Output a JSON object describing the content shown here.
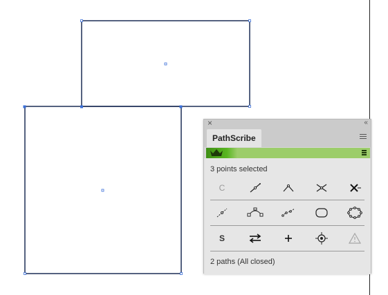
{
  "panel": {
    "close_glyph": "×",
    "collapse_glyph": "‹‹",
    "tab_label": "PathScribe",
    "selection_status": "3 points selected",
    "path_status": "2 paths (All closed)",
    "accent": "#58b521"
  },
  "buttons": {
    "row1": [
      {
        "icon": "c-letter-icon",
        "label": "C"
      },
      {
        "icon": "line-segment-icon"
      },
      {
        "icon": "corner-point-icon"
      },
      {
        "icon": "scissors-icon"
      },
      {
        "icon": "delete-point-icon"
      }
    ],
    "row2": [
      {
        "icon": "smooth-segment-icon"
      },
      {
        "icon": "arc-handles-icon"
      },
      {
        "icon": "distribute-points-icon"
      },
      {
        "icon": "smooth-shape-icon"
      },
      {
        "icon": "points-on-shape-icon"
      }
    ],
    "row3": [
      {
        "icon": "s-letter-icon",
        "label": "S"
      },
      {
        "icon": "swap-arrows-icon"
      },
      {
        "icon": "plus-icon"
      },
      {
        "icon": "target-point-icon"
      },
      {
        "icon": "warning-icon"
      }
    ]
  }
}
